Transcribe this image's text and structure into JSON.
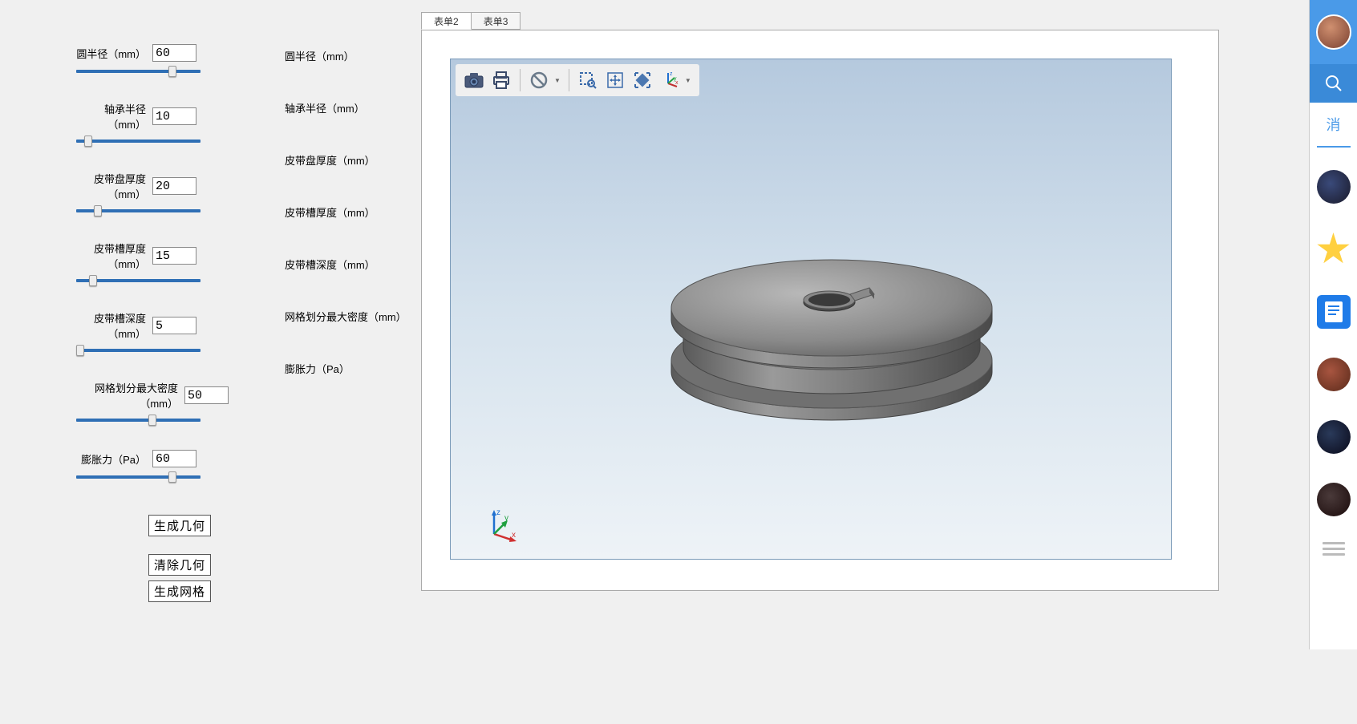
{
  "params": [
    {
      "label": "圆半径（mm）",
      "value": "60",
      "thumb": 115,
      "rlabel": "圆半径（mm）"
    },
    {
      "label": "轴承半径（mm）",
      "value": "10",
      "thumb": 10,
      "rlabel": "轴承半径（mm）"
    },
    {
      "label": "皮带盘厚度（mm）",
      "value": "20",
      "thumb": 22,
      "rlabel": "皮带盘厚度（mm）"
    },
    {
      "label": "皮带槽厚度（mm）",
      "value": "15",
      "thumb": 16,
      "rlabel": "皮带槽厚度（mm）"
    },
    {
      "label": "皮带槽深度（mm）",
      "value": "5",
      "thumb": 0,
      "rlabel": "皮带槽深度（mm）"
    },
    {
      "label": "网格划分最大密度（mm）",
      "value": "50",
      "thumb": 90,
      "rlabel": "网格划分最大密度（mm）",
      "wide": true
    },
    {
      "label": "膨胀力（Pa）",
      "value": "60",
      "thumb": 115,
      "rlabel": "膨胀力（Pa）"
    }
  ],
  "buttons": {
    "generate_geom": "生成几何",
    "clear_geom": "清除几何",
    "generate_mesh": "生成网格"
  },
  "tabs": [
    "表单2",
    "表单3"
  ],
  "active_tab": 0,
  "toolbar": {
    "camera": "camera-icon",
    "print": "print-icon",
    "forbid": "forbid-icon",
    "zoom_select": "zoom-select-icon",
    "pan": "pan-icon",
    "zoom_extents": "zoom-extents-icon",
    "axes": "axes-icon"
  },
  "sidebar": {
    "label": "消"
  }
}
